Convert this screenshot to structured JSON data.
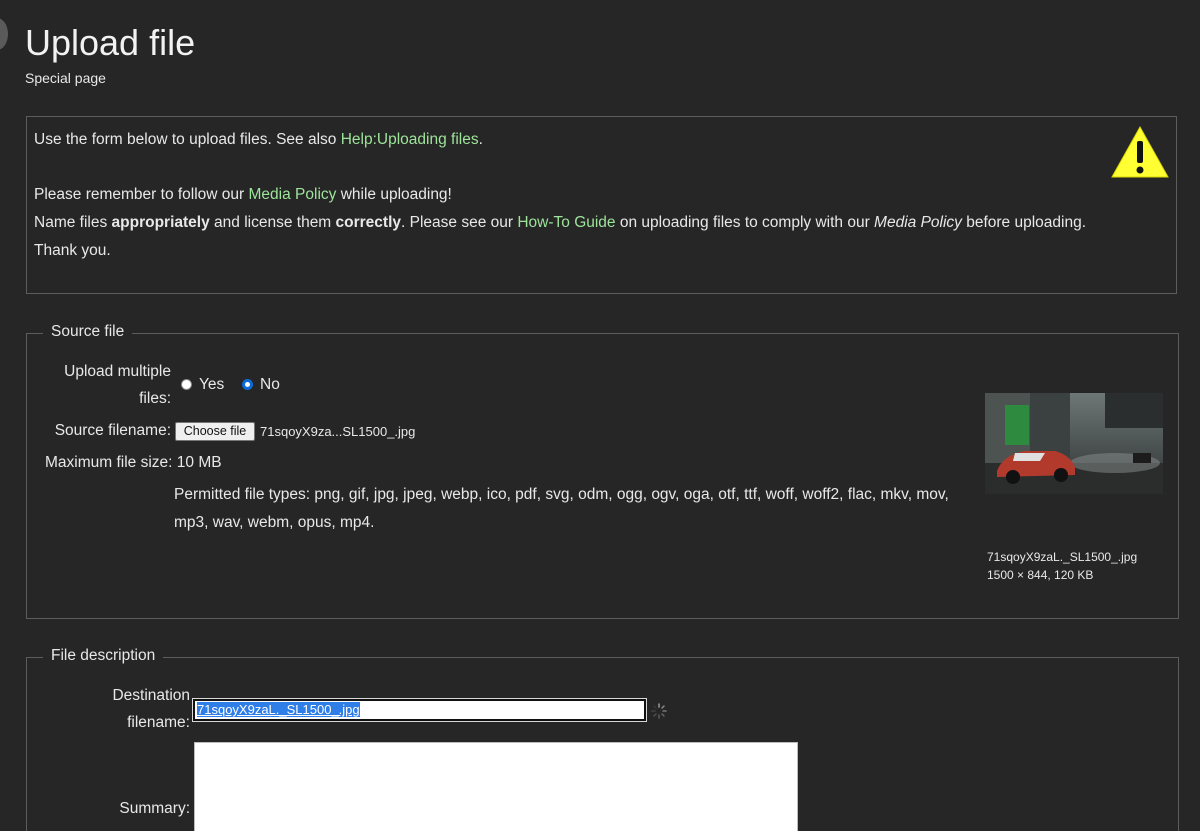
{
  "page": {
    "title": "Upload file",
    "subtitle": "Special page"
  },
  "notice": {
    "line1_prefix": "Use the form below to upload files. See also ",
    "line1_link": "Help:Uploading files",
    "line1_suffix": ".",
    "line2_prefix": "Please remember to follow our ",
    "line2_link": "Media Policy",
    "line2_suffix": " while uploading!",
    "line3_a": "Name files ",
    "line3_b": "appropriately",
    "line3_c": " and license them ",
    "line3_d": "correctly",
    "line3_e": ". Please see our ",
    "line3_link": "How-To Guide",
    "line3_f": " on uploading files to comply with our ",
    "line3_g": "Media Policy",
    "line3_h": " before uploading.",
    "line4": "Thank you.",
    "warning_icon": "warning-triangle-icon",
    "warning_color": "#ffff33"
  },
  "source": {
    "legend": "Source file",
    "multiple_label_1": "Upload multiple",
    "multiple_label_2": "files:",
    "yes_label": "Yes",
    "no_label": "No",
    "selected": "No",
    "filename_label": "Source filename:",
    "choose_button": "Choose file",
    "chosen_file": "71sqoyX9za...SL1500_.jpg",
    "max_size_label": "Maximum file size: 10 MB",
    "permitted_label": "Permitted file types: png, gif, jpg, jpeg, webp, ico, pdf, svg, odm, ogg, ogv, oga, otf, ttf, woff, woff2, flac, mkv, mov, mp3, wav, webm, opus, mp4.",
    "thumb_name": "71sqoyX9zaL._SL1500_.jpg",
    "thumb_info": "1500 × 844, 120 KB"
  },
  "description": {
    "legend": "File description",
    "dest_label_1": "Destination",
    "dest_label_2": "filename:",
    "dest_value": "71sqoyX9zaL._SL1500_.jpg",
    "summary_label": "Summary:"
  },
  "colors": {
    "background": "#262626",
    "link": "#9ee49a",
    "radio_checked": "#0d6bd8",
    "selection": "#2f7ee8"
  }
}
